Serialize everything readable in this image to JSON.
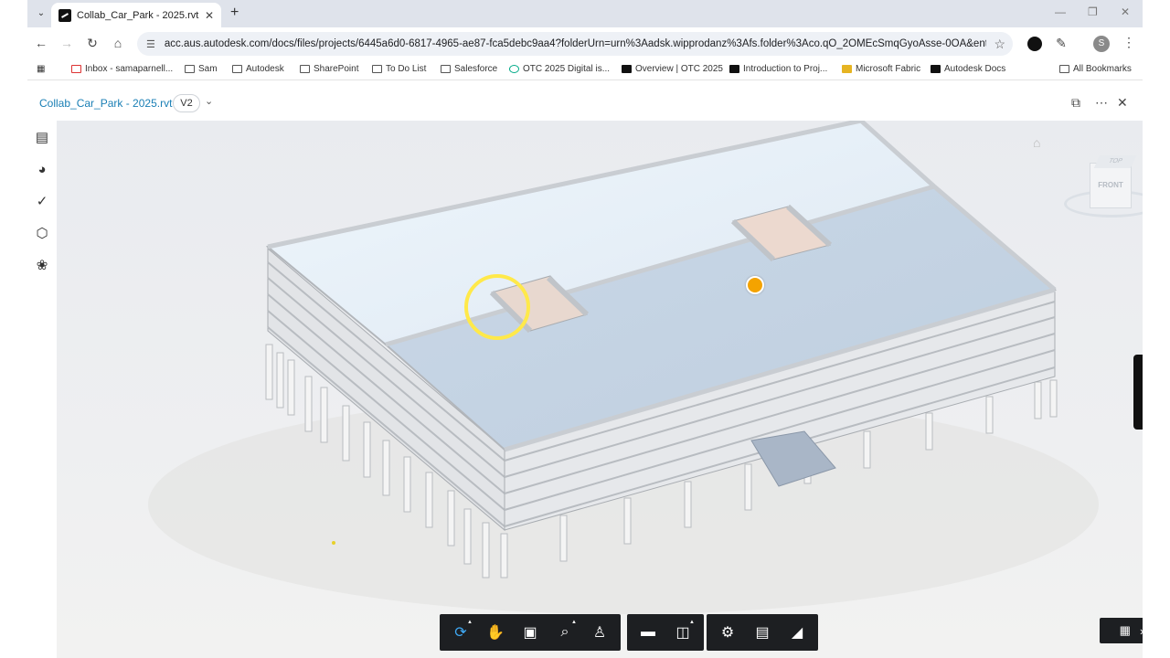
{
  "browser": {
    "tab_title": "Collab_Car_Park - 2025.rvt (V2)",
    "url": "acc.aus.autodesk.com/docs/files/projects/6445a6d0-6817-4965-ae87-fca5debc9aa4?folderUrn=urn%3Aadsk.wipprodanz%3Afs.folder%3Aco.qO_2OMEcSmqGyoAsse-0OA&entityId...",
    "profile_initial": "S"
  },
  "bookmarks": [
    {
      "label": "Inbox - samaparnell...",
      "icon": "gmail"
    },
    {
      "label": "Sam",
      "icon": "folder"
    },
    {
      "label": "Autodesk",
      "icon": "folder"
    },
    {
      "label": "SharePoint",
      "icon": "page"
    },
    {
      "label": "To Do List",
      "icon": "folder"
    },
    {
      "label": "Salesforce",
      "icon": "folder"
    },
    {
      "label": "OTC 2025 Digital is...",
      "icon": "otc"
    },
    {
      "label": "Overview | OTC 2025",
      "icon": "autodesk"
    },
    {
      "label": "Introduction to Proj...",
      "icon": "autodesk"
    },
    {
      "label": "Microsoft Fabric",
      "icon": "fabric"
    },
    {
      "label": "Autodesk Docs",
      "icon": "autodesk"
    },
    {
      "label": "All Bookmarks",
      "icon": "folder"
    }
  ],
  "app": {
    "file_name": "Collab_Car_Park - 2025.rvt",
    "version": "V2"
  },
  "viewcube": {
    "top_label": "TOP",
    "front_label": "FRONT"
  },
  "left_rail": [
    "model-browser-icon",
    "layers-icon",
    "checklist-icon",
    "object-properties-icon",
    "fan-icon"
  ],
  "toolbar": {
    "navigation": [
      "orbit-icon",
      "pan-icon",
      "fit-to-view-icon",
      "zoom-window-icon",
      "first-person-icon"
    ],
    "measure": [
      "measure-icon",
      "section-icon"
    ],
    "settings": [
      "settings-icon",
      "properties-icon",
      "fullscreen-icon"
    ]
  },
  "accent_color": "#1a7fb5",
  "marker_color": "#f4a300"
}
